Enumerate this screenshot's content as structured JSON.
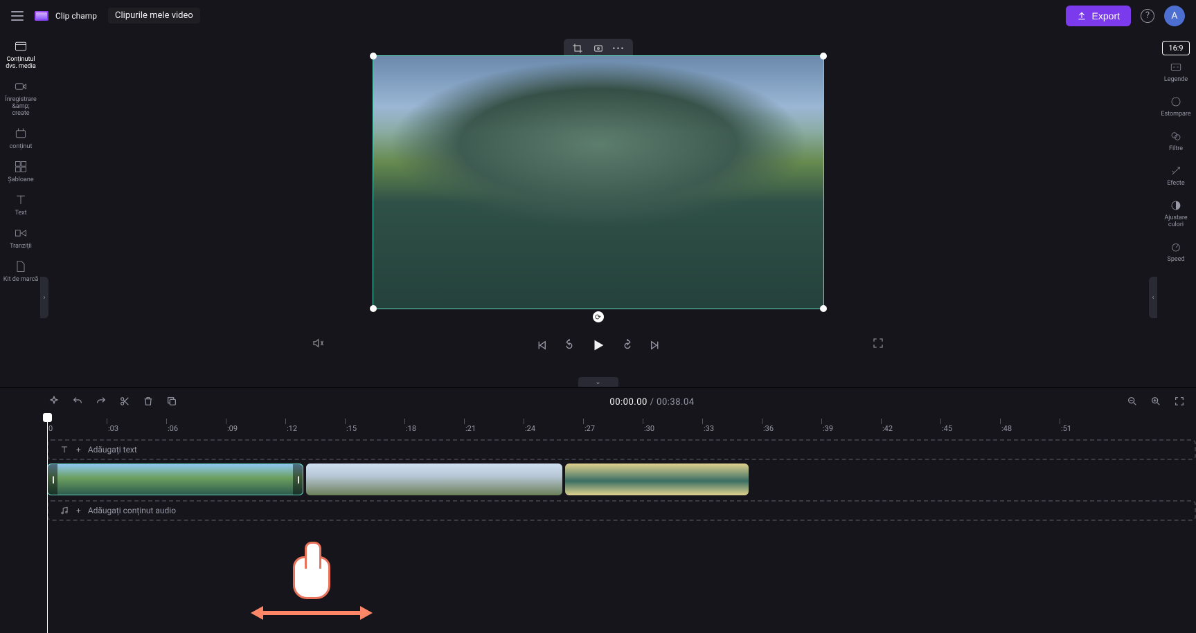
{
  "header": {
    "brand": "Clip champ",
    "projectName": "Clipurile mele video",
    "exportLabel": "Export",
    "avatarInitial": "A"
  },
  "leftRail": {
    "media": "Conținutul dvs. media",
    "record": "Înregistrare &amp;\ncreate",
    "content": "conținut",
    "templates": "Șabloane",
    "text": "Text",
    "transitions": "Tranziții",
    "brandkit": "Kit de marcă"
  },
  "rightRail": {
    "ratio": "16:9",
    "captions": "Legende",
    "fade": "Estompare",
    "filters": "Filtre",
    "effects": "Efecte",
    "colors": "Ajustare culori",
    "speed": "Speed"
  },
  "player": {
    "timecodeCurrent": "00:00.00",
    "timecodeSep": "/",
    "timecodeTotal": "00:38.04"
  },
  "ruler": {
    "ticks": [
      "0",
      ":03",
      ":06",
      ":09",
      ":12",
      ":15",
      ":18",
      ":21",
      ":24",
      ":27",
      ":30",
      ":33",
      ":36",
      ":39",
      ":42",
      ":45",
      ":48",
      ":51"
    ]
  },
  "tracks": {
    "addText": "Adăugați text",
    "addAudio": "Adăugați conținut audio"
  }
}
